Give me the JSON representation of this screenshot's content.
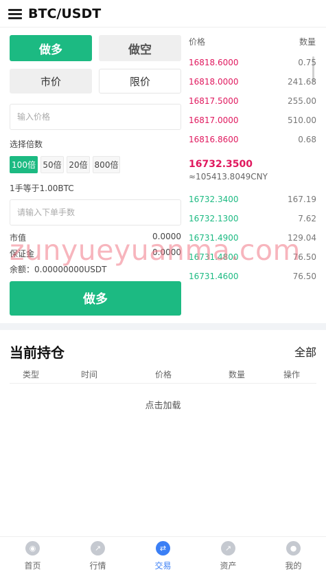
{
  "header": {
    "title": "BTC/USDT"
  },
  "trade": {
    "long_tab": "做多",
    "short_tab": "做空",
    "market_label": "市价",
    "limit_label": "限价",
    "price_placeholder": "输入价格",
    "leverage_label": "选择倍数",
    "leverages": [
      "100倍",
      "50倍",
      "20倍",
      "800倍"
    ],
    "lot_info": "1手等于1.00BTC",
    "qty_placeholder": "请输入下单手数",
    "market_value_label": "市值",
    "market_value": "0.0000",
    "margin_label": "保证金",
    "margin": "0.0000",
    "balance": "余额：0.00000000USDT",
    "submit_label": "做多"
  },
  "orderbook": {
    "price_header": "价格",
    "qty_header": "数量",
    "asks": [
      {
        "price": "16818.6000",
        "qty": "0.75"
      },
      {
        "price": "16818.0000",
        "qty": "241.68"
      },
      {
        "price": "16817.5000",
        "qty": "255.00"
      },
      {
        "price": "16817.0000",
        "qty": "510.00"
      },
      {
        "price": "16816.8600",
        "qty": "0.68"
      }
    ],
    "last_price": "16732.3500",
    "last_price_cny": "≈105413.8049CNY",
    "bids": [
      {
        "price": "16732.3400",
        "qty": "167.19"
      },
      {
        "price": "16732.1300",
        "qty": "7.62"
      },
      {
        "price": "16731.4900",
        "qty": "129.04"
      },
      {
        "price": "16731.4800",
        "qty": "76.50"
      },
      {
        "price": "16731.4600",
        "qty": "76.50"
      }
    ],
    "ask_color": "#e0185e",
    "bid_color": "#1cba82"
  },
  "positions": {
    "title": "当前持仓",
    "all_label": "全部",
    "columns": [
      "类型",
      "时间",
      "价格",
      "数量",
      "操作"
    ],
    "load_more": "点击加载"
  },
  "watermark": "zunyueyuanma.com",
  "tabbar": {
    "items": [
      {
        "label": "首页",
        "icon": "home-icon"
      },
      {
        "label": "行情",
        "icon": "market-trend-icon"
      },
      {
        "label": "交易",
        "icon": "trade-icon"
      },
      {
        "label": "资产",
        "icon": "assets-icon"
      },
      {
        "label": "我的",
        "icon": "user-icon"
      }
    ],
    "active_index": 2,
    "active_color": "#3b7ff5"
  }
}
